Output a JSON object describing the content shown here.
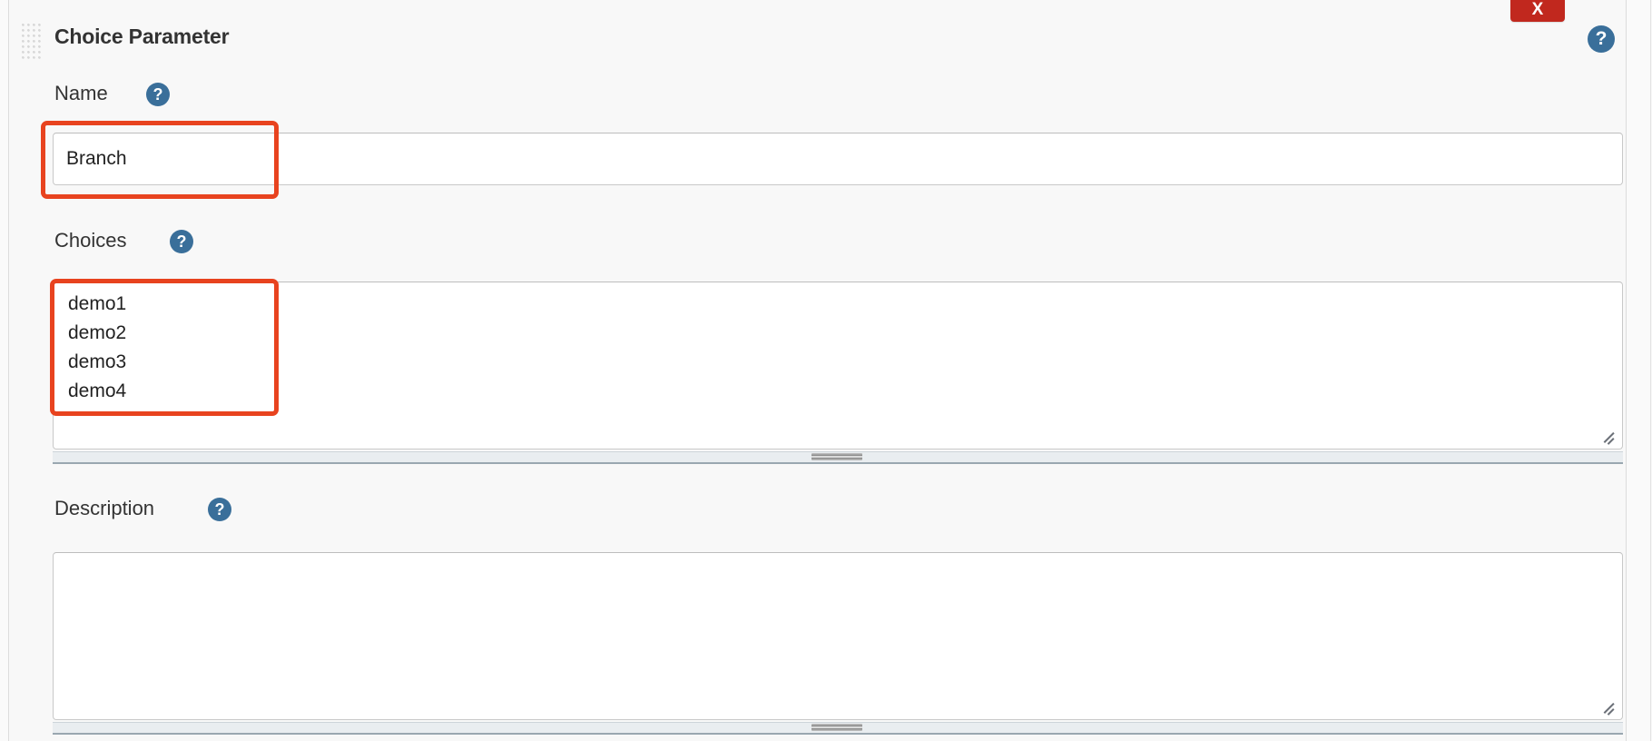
{
  "panel": {
    "title": "Choice Parameter",
    "drag_handle_name": "drag-handle",
    "close_label": "X",
    "help_glyph": "?"
  },
  "fields": {
    "name": {
      "label": "Name",
      "help_glyph": "?",
      "value": "Branch",
      "placeholder": ""
    },
    "choices": {
      "label": "Choices",
      "help_glyph": "?",
      "value": "demo1\ndemo2\ndemo3\ndemo4",
      "items": [
        "demo1",
        "demo2",
        "demo3",
        "demo4"
      ],
      "placeholder": ""
    },
    "description": {
      "label": "Description",
      "help_glyph": "?",
      "value": "",
      "placeholder": ""
    }
  },
  "colors": {
    "page_background": "#f8f8f8",
    "panel_background": "#f8f8f8",
    "text": "#333333",
    "help_icon_blue": "#3a6f9a",
    "close_button_red": "#c1281e",
    "annotation_red": "#e8431f",
    "input_border": "#c8c8c8",
    "scrollbar_track": "#e9edf0",
    "scrollbar_thumb": "#8e8e8e"
  }
}
